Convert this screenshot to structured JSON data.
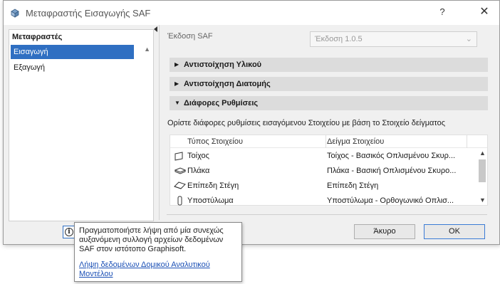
{
  "window": {
    "title": "Μεταφραστής Εισαγωγής SAF",
    "help": "?",
    "close": "✕"
  },
  "sidebar": {
    "header": "Μεταφραστές",
    "items": [
      {
        "label": "Εισαγωγή",
        "selected": true
      },
      {
        "label": "Εξαγωγή",
        "selected": false
      }
    ]
  },
  "main": {
    "version_label": "Έκδοση SAF",
    "version_value": "Έκδοση 1.0.5",
    "sections": [
      {
        "label": "Αντιστοίχηση Υλικού",
        "expanded": false
      },
      {
        "label": "Αντιστοίχηση Διατομής",
        "expanded": false
      },
      {
        "label": "Διάφορες Ρυθμίσεις",
        "expanded": true
      }
    ],
    "description": "Ορίστε διάφορες ρυθμίσεις εισαγόμενου Στοιχείου με βάση το Στοιχείο δείγματος",
    "table": {
      "columns": [
        "Τύπος Στοιχείου",
        "Δείγμα Στοιχείου"
      ],
      "rows": [
        {
          "icon": "wall-icon",
          "type": "Τοίχος",
          "sample": "Τοίχος - Βασικός Οπλισμένου Σκυρ..."
        },
        {
          "icon": "slab-icon",
          "type": "Πλάκα",
          "sample": "Πλάκα - Βασική Οπλισμένου Σκυρο..."
        },
        {
          "icon": "roof-icon",
          "type": "Επίπεδη Στέγη",
          "sample": "Επίπεδη Στέγη"
        },
        {
          "icon": "column-icon",
          "type": "Υποστύλωμα",
          "sample": "Υποστύλωμα - Ορθογωνικό Οπλισ..."
        }
      ]
    }
  },
  "buttons": {
    "cancel": "Άκυρο",
    "ok": "OK"
  },
  "info": {
    "icon": "info-icon",
    "tooltip_text": "Πραγματοποιήστε λήψη από μία συνεχώς αυξανόμενη συλλογή αρχείων δεδομένων SAF στον ιστότοπο Graphisoft.",
    "tooltip_link": "Λήψη δεδομένων Δομικού Αναλυτικού Μοντέλου"
  }
}
